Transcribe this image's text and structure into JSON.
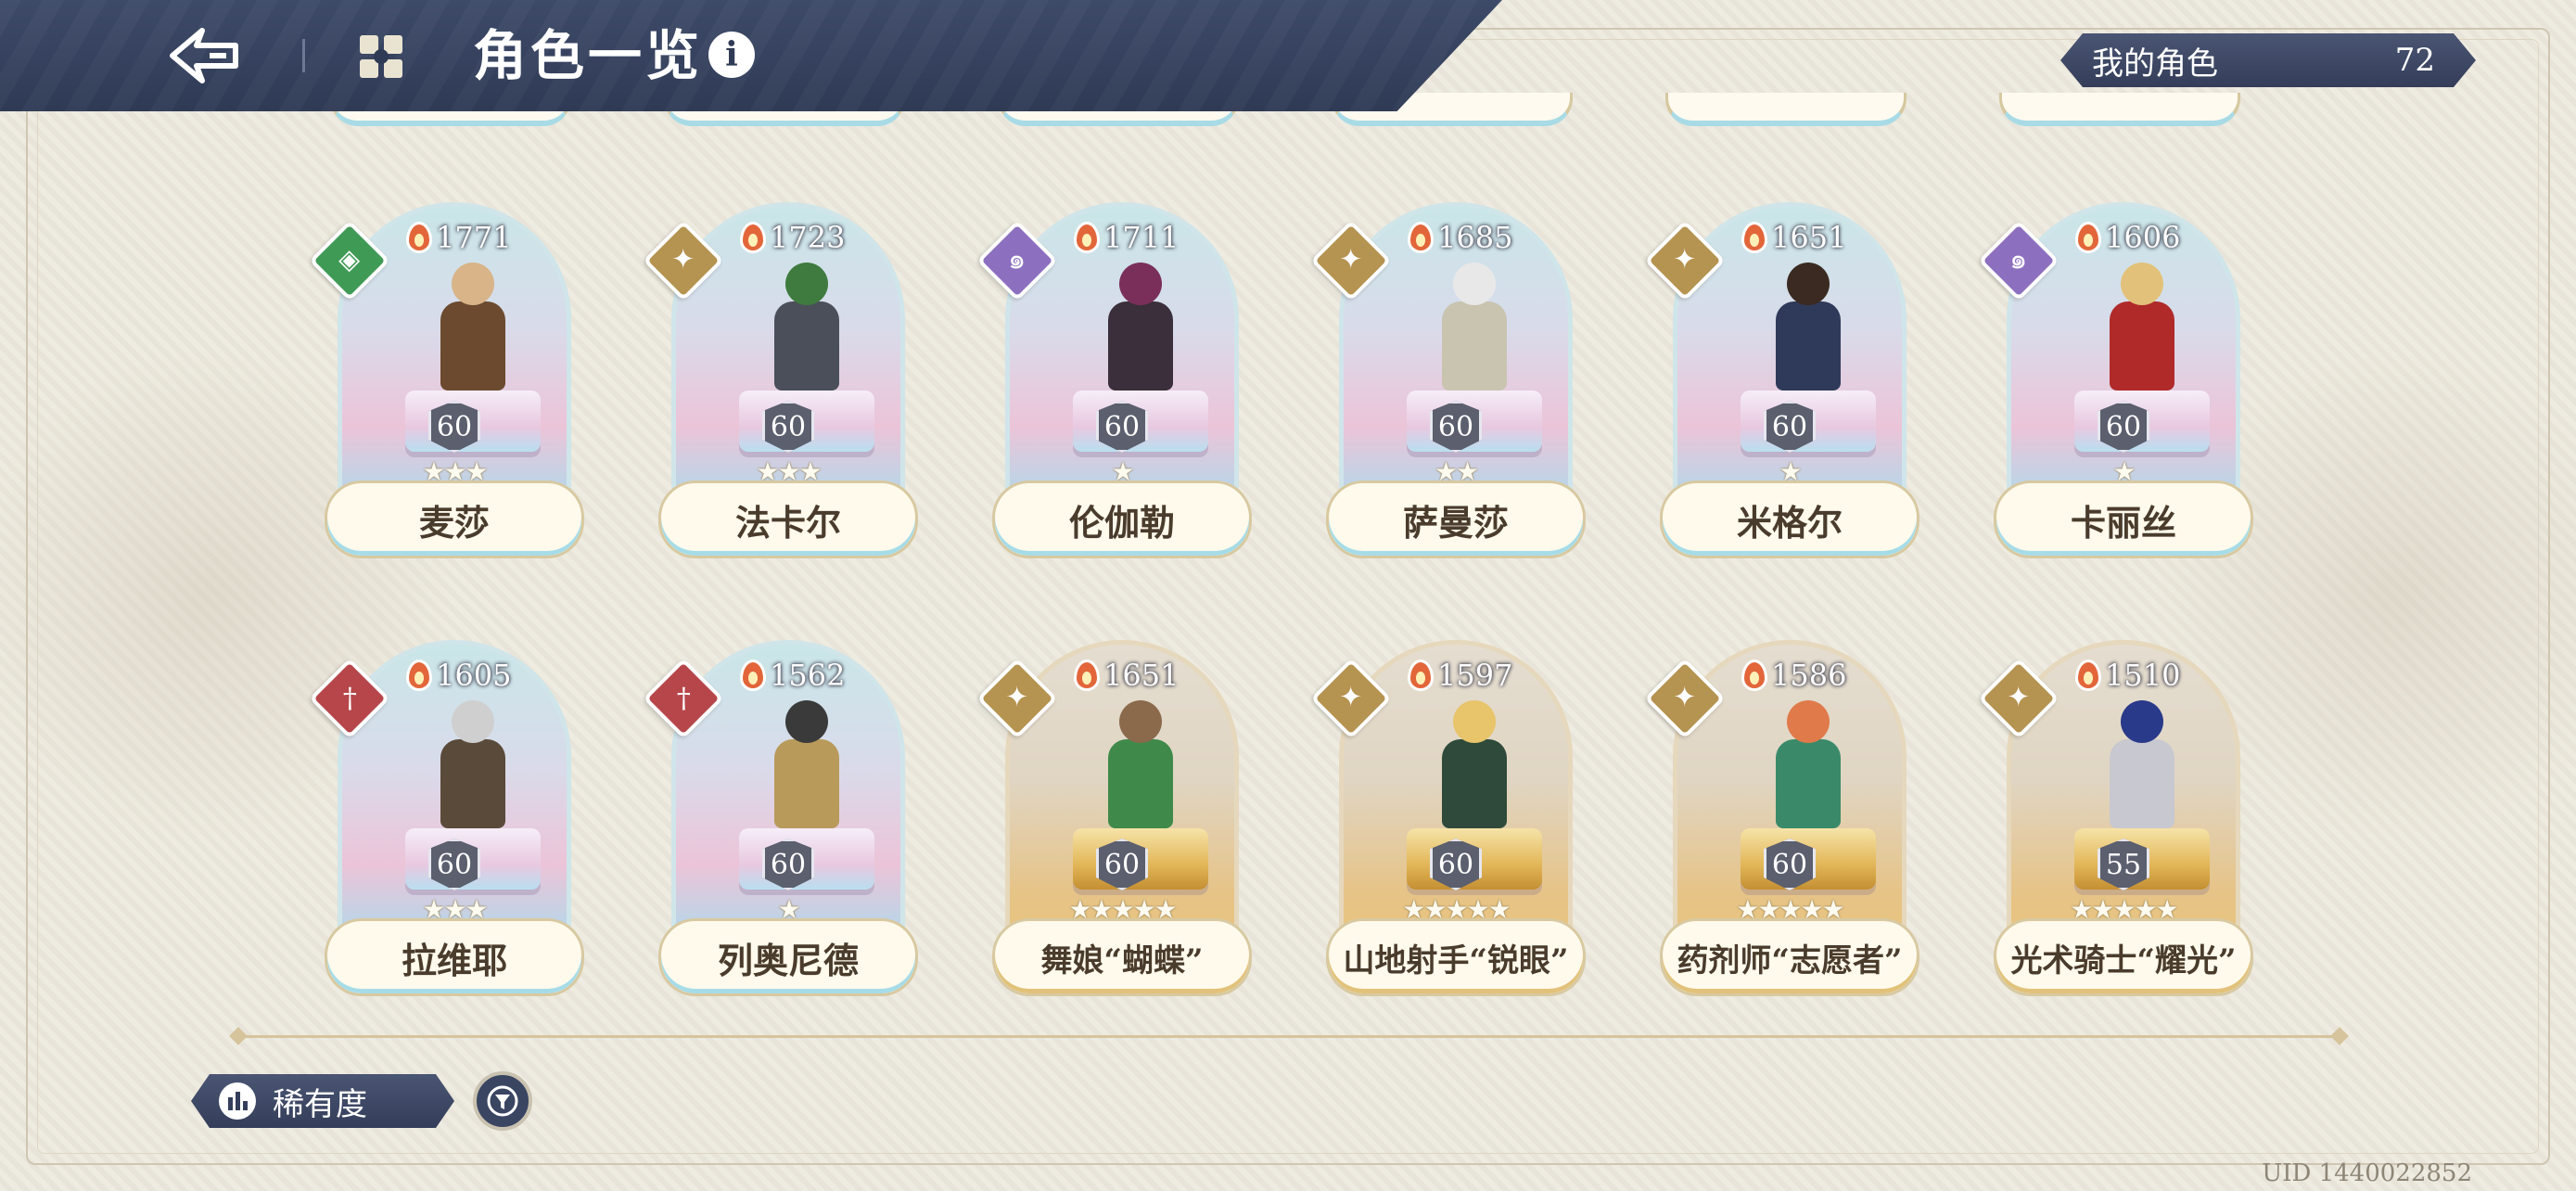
{
  "header": {
    "title": "角色一览",
    "info_icon": "i"
  },
  "my_roles": {
    "label": "我的角色",
    "count": "72"
  },
  "characters": [
    {
      "name": "麦莎",
      "power": "1771",
      "level": "60",
      "stars": "★★★",
      "element": "green",
      "element_icon": "shield-icon",
      "rarity": "epic",
      "colors": {
        "hair": "#d8b488",
        "outfit": "#6b4a2f"
      }
    },
    {
      "name": "法卡尔",
      "power": "1723",
      "level": "60",
      "stars": "★★★",
      "element": "gold",
      "element_icon": "compass-icon",
      "rarity": "epic",
      "colors": {
        "hair": "#3f7a3e",
        "outfit": "#4a4f5a"
      }
    },
    {
      "name": "伦伽勒",
      "power": "1711",
      "level": "60",
      "stars": "★",
      "element": "purple",
      "element_icon": "swirl-icon",
      "rarity": "epic",
      "colors": {
        "hair": "#7a2f5a",
        "outfit": "#3a2f3a"
      }
    },
    {
      "name": "萨曼莎",
      "power": "1685",
      "level": "60",
      "stars": "★★",
      "element": "gold",
      "element_icon": "compass-icon",
      "rarity": "epic",
      "colors": {
        "hair": "#e8e8e8",
        "outfit": "#c8c4b0"
      }
    },
    {
      "name": "米格尔",
      "power": "1651",
      "level": "60",
      "stars": "★",
      "element": "gold",
      "element_icon": "compass-icon",
      "rarity": "epic",
      "colors": {
        "hair": "#3a2a22",
        "outfit": "#2f3a5a"
      }
    },
    {
      "name": "卡丽丝",
      "power": "1606",
      "level": "60",
      "stars": "★",
      "element": "purple",
      "element_icon": "swirl-icon",
      "rarity": "epic",
      "colors": {
        "hair": "#e2c27a",
        "outfit": "#b02a2a"
      }
    },
    {
      "name": "拉维耶",
      "power": "1605",
      "level": "60",
      "stars": "★★★",
      "element": "red",
      "element_icon": "sword-icon",
      "rarity": "epic",
      "colors": {
        "hair": "#cfcfcf",
        "outfit": "#5a4a3a"
      }
    },
    {
      "name": "列奥尼德",
      "power": "1562",
      "level": "60",
      "stars": "★",
      "element": "red",
      "element_icon": "sword-icon",
      "rarity": "epic",
      "colors": {
        "hair": "#3a3a3a",
        "outfit": "#b89a5a"
      }
    },
    {
      "name": "舞娘“蝴蝶”",
      "power": "1651",
      "level": "60",
      "stars": "★★★★★",
      "element": "gold",
      "element_icon": "compass-icon",
      "rarity": "gold",
      "colors": {
        "hair": "#8a6a4a",
        "outfit": "#3f8a4a"
      }
    },
    {
      "name": "山地射手“锐眼”",
      "power": "1597",
      "level": "60",
      "stars": "★★★★★",
      "element": "gold",
      "element_icon": "compass-icon",
      "rarity": "gold",
      "colors": {
        "hair": "#e8c46a",
        "outfit": "#2f4a3a"
      }
    },
    {
      "name": "药剂师“志愿者”",
      "power": "1586",
      "level": "60",
      "stars": "★★★★★",
      "element": "gold",
      "element_icon": "compass-icon",
      "rarity": "gold",
      "colors": {
        "hair": "#e07a4a",
        "outfit": "#3a8a6a"
      }
    },
    {
      "name": "光术骑士“耀光”",
      "power": "1510",
      "level": "55",
      "stars": "★★★★★",
      "element": "gold",
      "element_icon": "compass-icon",
      "rarity": "gold",
      "colors": {
        "hair": "#2a3a8a",
        "outfit": "#c8c8d0"
      }
    }
  ],
  "footer": {
    "sort_label": "稀有度",
    "uid": "UID 1440022852"
  }
}
